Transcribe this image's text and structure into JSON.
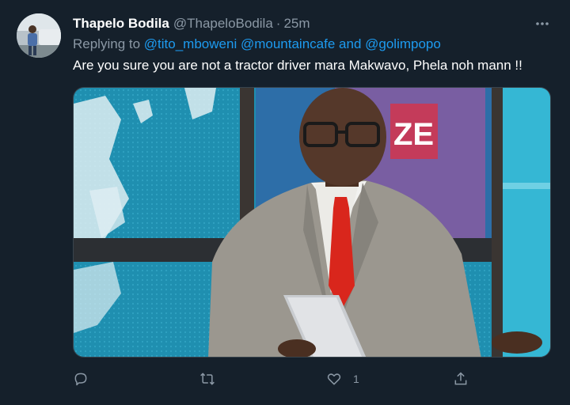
{
  "tweet": {
    "author_name": "Thapelo Bodila",
    "author_handle": "@ThapeloBodila",
    "separator": "·",
    "time": "25m",
    "replying_prefix": "Replying to",
    "mentions": [
      "@tito_mboweni",
      "@mountaincafe",
      "@golimpopo"
    ],
    "mention_joiner": "and",
    "text": "Are you sure you are not a tractor driver mara Makwavo, Phela noh mann !!",
    "more_icon": "more-horizontal-icon",
    "media": {
      "screen_text": "ZE",
      "colors": {
        "map_blue": "#1f8fb0",
        "suit": "#9b978f",
        "tie": "#d9261c"
      }
    },
    "actions": {
      "reply_icon": "reply-icon",
      "retweet_icon": "retweet-icon",
      "like_icon": "heart-icon",
      "share_icon": "share-icon",
      "like_count": "1"
    }
  },
  "colors": {
    "background": "#15202b",
    "accent": "#1d9bf0",
    "secondary_text": "#8b98a5"
  }
}
